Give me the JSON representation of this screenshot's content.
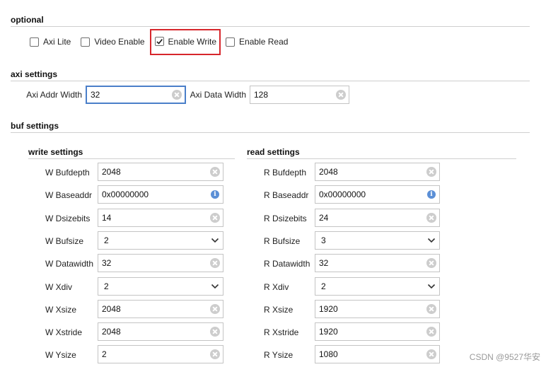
{
  "optional": {
    "title": "optional",
    "checkboxes": [
      {
        "label": "Axi Lite",
        "checked": false
      },
      {
        "label": "Video Enable",
        "checked": false
      },
      {
        "label": "Enable Write",
        "checked": true,
        "highlighted": true
      },
      {
        "label": "Enable Read",
        "checked": false
      }
    ]
  },
  "axi": {
    "title": "axi settings",
    "addr_label": "Axi Addr Width",
    "addr_value": "32",
    "data_label": "Axi Data Width",
    "data_value": "128"
  },
  "buf": {
    "title": "buf settings",
    "write": {
      "title": "write settings",
      "rows": [
        {
          "label": "W Bufdepth",
          "value": "2048",
          "type": "text"
        },
        {
          "label": "W Baseaddr",
          "value": "0x00000000",
          "type": "info"
        },
        {
          "label": "W Dsizebits",
          "value": "14",
          "type": "text"
        },
        {
          "label": "W Bufsize",
          "value": "2",
          "type": "select"
        },
        {
          "label": "W Datawidth",
          "value": "32",
          "type": "text"
        },
        {
          "label": "W Xdiv",
          "value": "2",
          "type": "select"
        },
        {
          "label": "W Xsize",
          "value": "2048",
          "type": "text"
        },
        {
          "label": "W Xstride",
          "value": "2048",
          "type": "text"
        },
        {
          "label": "W Ysize",
          "value": "2",
          "type": "text"
        }
      ]
    },
    "read": {
      "title": "read settings",
      "rows": [
        {
          "label": "R Bufdepth",
          "value": "2048",
          "type": "text"
        },
        {
          "label": "R Baseaddr",
          "value": "0x00000000",
          "type": "info"
        },
        {
          "label": "R Dsizebits",
          "value": "24",
          "type": "text"
        },
        {
          "label": "R Bufsize",
          "value": "3",
          "type": "select"
        },
        {
          "label": "R Datawidth",
          "value": "32",
          "type": "text"
        },
        {
          "label": "R Xdiv",
          "value": "2",
          "type": "select"
        },
        {
          "label": "R Xsize",
          "value": "1920",
          "type": "text"
        },
        {
          "label": "R Xstride",
          "value": "1920",
          "type": "text"
        },
        {
          "label": "R Ysize",
          "value": "1080",
          "type": "text"
        }
      ]
    }
  },
  "watermark": "CSDN @9527华安",
  "colors": {
    "highlight": "#d7262c",
    "focus": "#4a7fc9",
    "info": "#5b8fd6"
  }
}
